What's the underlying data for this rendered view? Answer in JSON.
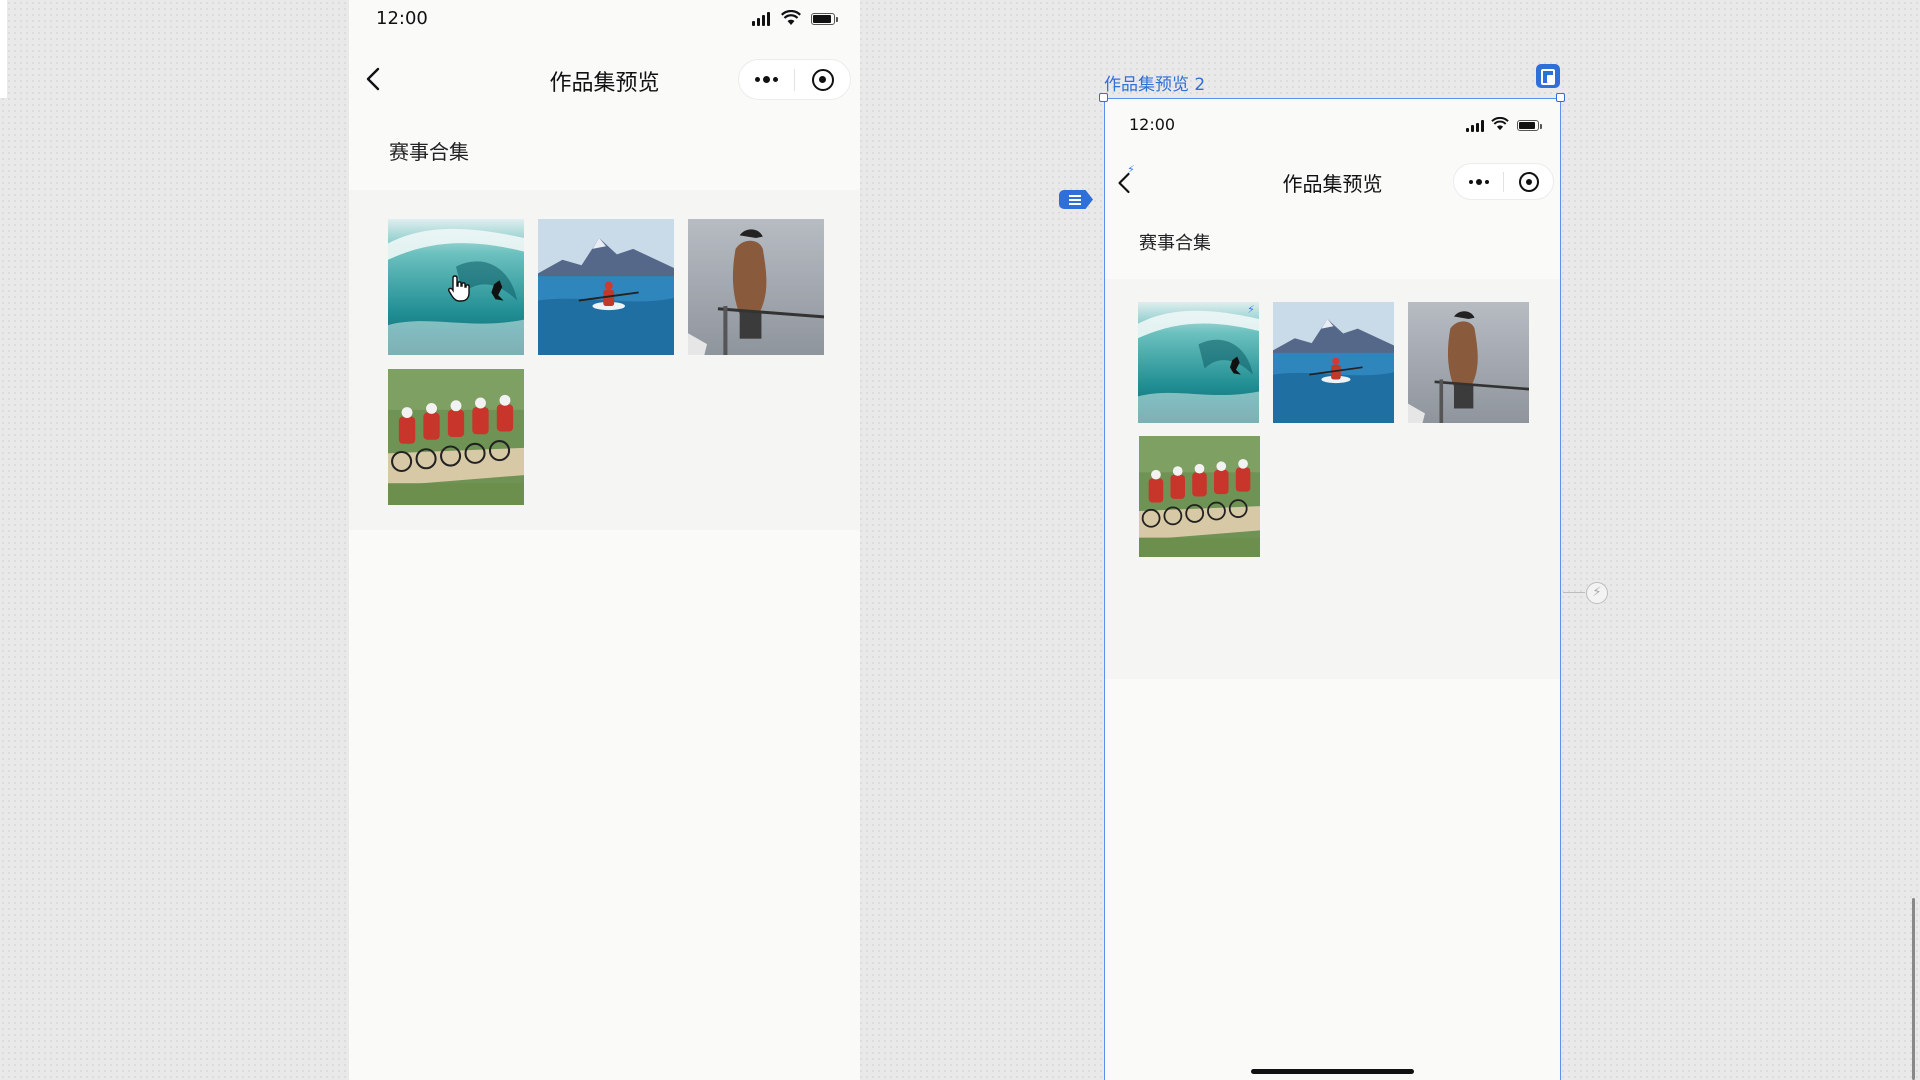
{
  "left_phone": {
    "status_time": "12:00",
    "nav_title": "作品集预览",
    "section_title": "赛事合集",
    "thumbnails": [
      {
        "name": "surfing-wave",
        "color": "#2a9a9a"
      },
      {
        "name": "kayak-lake",
        "color": "#2d7fb8"
      },
      {
        "name": "bar-athlete",
        "color": "#9aa0a6"
      },
      {
        "name": "cyclists-race",
        "color": "#6a8c4a"
      }
    ]
  },
  "right_phone": {
    "frame_label": "作品集预览 2",
    "status_time": "12:00",
    "nav_title": "作品集预览",
    "section_title": "赛事合集"
  },
  "colors": {
    "selection": "#2f6fd8",
    "canvas": "#e9e9e9"
  }
}
